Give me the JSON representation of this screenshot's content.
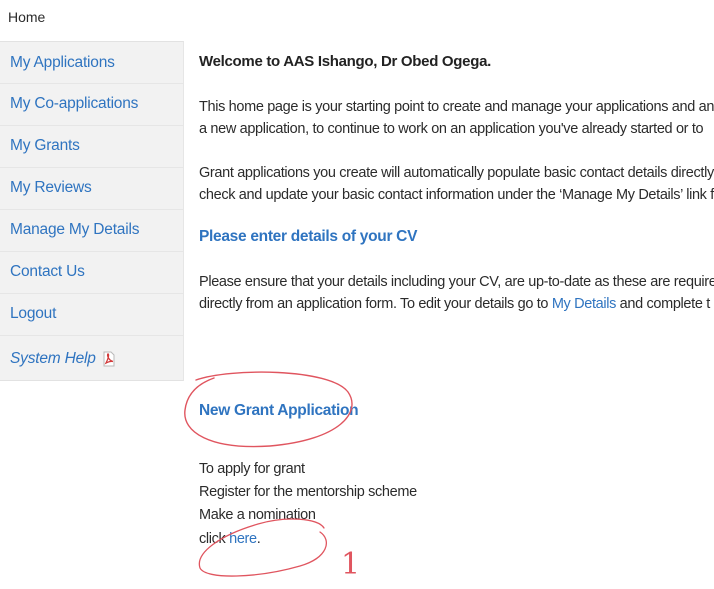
{
  "breadcrumb": "Home",
  "sidebar": {
    "items": [
      {
        "label": "My Applications"
      },
      {
        "label": "My Co-applications"
      },
      {
        "label": "My Grants"
      },
      {
        "label": "My Reviews"
      },
      {
        "label": "Manage My Details"
      },
      {
        "label": "Contact Us"
      },
      {
        "label": "Logout"
      }
    ],
    "help": {
      "label": "System Help",
      "icon": "pdf-icon"
    }
  },
  "main": {
    "welcome": "Welcome to AAS Ishango, Dr Obed Ogega.",
    "para1": {
      "line1": "This home page is your starting point to create and manage your applications and an",
      "line2": "a new application, to continue to work on an application you've already started or to"
    },
    "para2": {
      "line1": "Grant applications you create will automatically populate basic contact details directly",
      "line2": "check and update your basic contact information under the ‘Manage My Details’ link f"
    },
    "cv_heading": "Please enter details of your CV",
    "para3": {
      "line1": "Please ensure that your details including your CV, are up-to-date as these are required",
      "line2_prefix": "directly from an application form. To edit your details go to ",
      "line2_link": "My Details",
      "line2_suffix": " and complete t"
    },
    "new_grant_heading": "New Grant Application",
    "list": {
      "line1": "To apply for grant",
      "line2": "Register for the mentorship scheme",
      "line3": "Make a nomination",
      "line4_prefix": "click ",
      "line4_link": "here",
      "line4_suffix": "."
    }
  },
  "annotations": {
    "number": "1",
    "color": "#e0555f"
  },
  "colors": {
    "link": "#2f74c0",
    "sidebar_bg": "#f2f2f2"
  }
}
